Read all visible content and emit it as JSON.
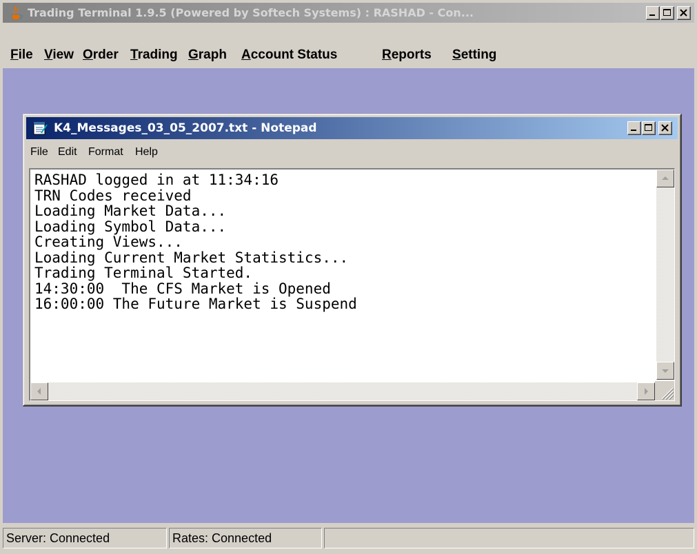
{
  "app": {
    "title": "Trading Terminal 1.9.5 (Powered by Softech Systems)   :   RASHAD - Con...",
    "icon": "java-cup-icon",
    "menu": [
      {
        "label": "File",
        "accel": "F"
      },
      {
        "label": "View",
        "accel": "V"
      },
      {
        "label": "Order",
        "accel": "O"
      },
      {
        "label": "Trading",
        "accel": "T"
      },
      {
        "label": "Graph",
        "accel": "G"
      },
      {
        "label": "Account Status",
        "accel": "A"
      },
      {
        "label": "Reports",
        "accel": "R"
      },
      {
        "label": "Setting",
        "accel": "S"
      }
    ]
  },
  "notepad": {
    "title": "K4_Messages_03_05_2007.txt - Notepad",
    "icon": "notepad-icon",
    "menu": [
      "File",
      "Edit",
      "Format",
      "Help"
    ],
    "lines": [
      "RASHAD logged in at 11:34:16",
      "TRN Codes received",
      "Loading Market Data...",
      "Loading Symbol Data...",
      "Creating Views...",
      "Loading Current Market Statistics...",
      "Trading Terminal Started.",
      "14:30:00  The CFS Market is Opened",
      "16:00:00 The Future Market is Suspend"
    ]
  },
  "statusbar": {
    "server": "Server: Connected",
    "rates": "Rates: Connected"
  },
  "colors": {
    "desktop": "#9c9ccf",
    "active_title_start": "#0a246a",
    "active_title_end": "#a6caf0",
    "inactive_title_start": "#808080",
    "chrome": "#d4d0c8"
  }
}
